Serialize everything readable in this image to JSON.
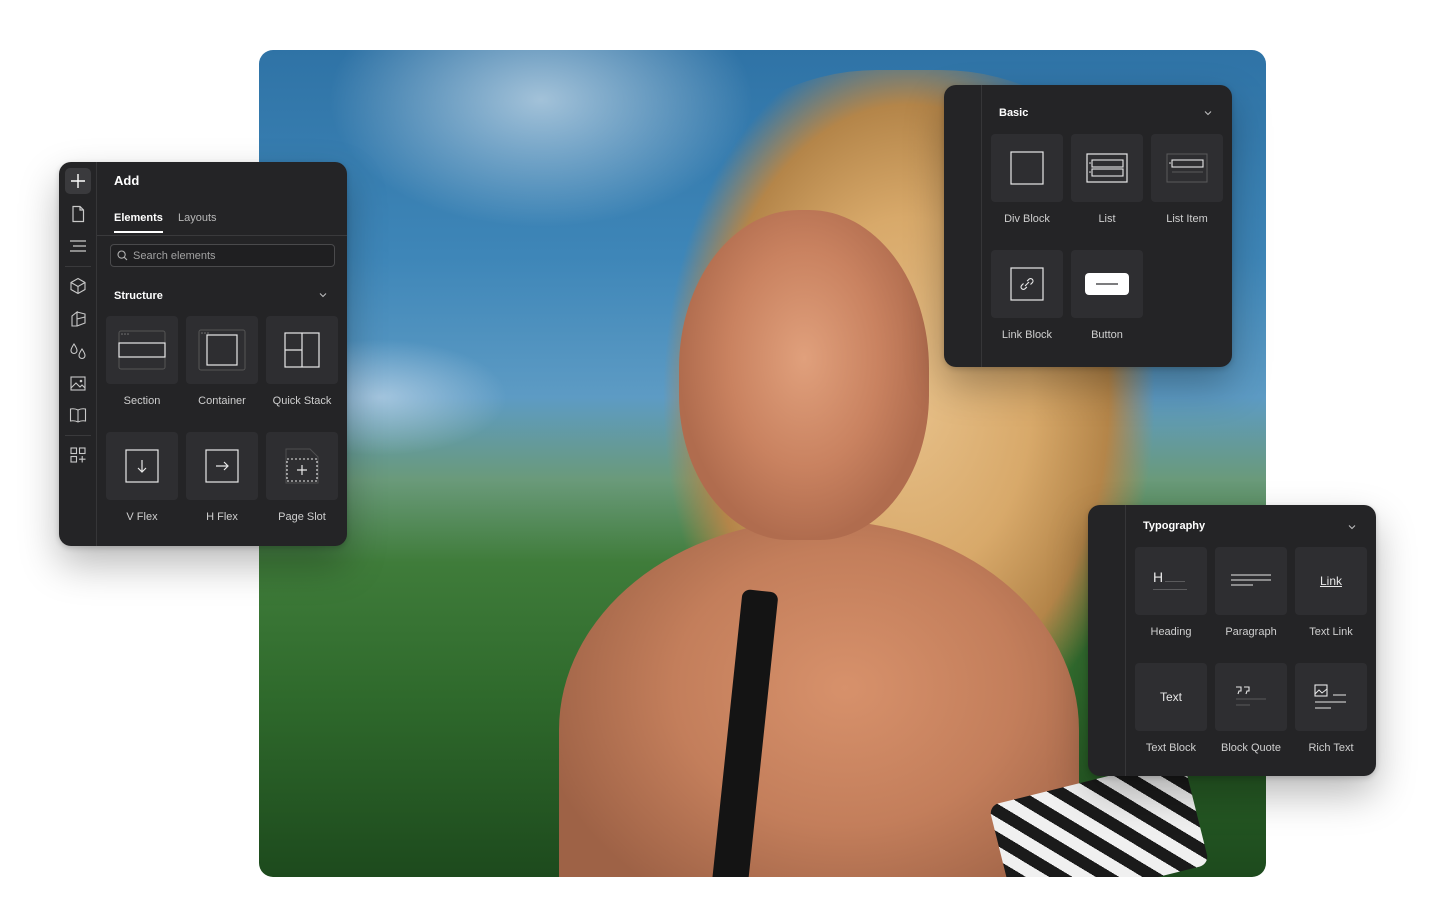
{
  "add_panel": {
    "title": "Add",
    "tabs": [
      {
        "label": "Elements",
        "active": true
      },
      {
        "label": "Layouts",
        "active": false
      }
    ],
    "search_placeholder": "Search elements",
    "section_title": "Structure",
    "items": [
      {
        "label": "Section",
        "icon": "section-icon"
      },
      {
        "label": "Container",
        "icon": "container-icon"
      },
      {
        "label": "Quick Stack",
        "icon": "quick-stack-icon"
      },
      {
        "label": "V Flex",
        "icon": "v-flex-icon"
      },
      {
        "label": "H Flex",
        "icon": "h-flex-icon"
      },
      {
        "label": "Page Slot",
        "icon": "page-slot-icon"
      }
    ],
    "rail_icons": [
      "plus-icon",
      "page-icon",
      "navigator-icon",
      "components-icon",
      "styles-icon",
      "variables-icon",
      "assets-icon",
      "cms-icon",
      "apps-icon"
    ]
  },
  "basic_panel": {
    "section_title": "Basic",
    "items": [
      {
        "label": "Div Block",
        "icon": "div-block-icon"
      },
      {
        "label": "List",
        "icon": "list-icon"
      },
      {
        "label": "List Item",
        "icon": "list-item-icon"
      },
      {
        "label": "Link Block",
        "icon": "link-block-icon"
      },
      {
        "label": "Button",
        "icon": "button-icon"
      }
    ]
  },
  "typography_panel": {
    "section_title": "Typography",
    "items": [
      {
        "label": "Heading",
        "icon": "heading-icon",
        "glyph": "H"
      },
      {
        "label": "Paragraph",
        "icon": "paragraph-icon"
      },
      {
        "label": "Text Link",
        "icon": "text-link-icon",
        "glyph": "Link"
      },
      {
        "label": "Text Block",
        "icon": "text-block-icon",
        "glyph": "Text"
      },
      {
        "label": "Block Quote",
        "icon": "block-quote-icon"
      },
      {
        "label": "Rich Text",
        "icon": "rich-text-icon"
      }
    ]
  },
  "colors": {
    "panel_bg": "#242426",
    "tile_bg": "#2e2e31",
    "text_primary": "#ffffff",
    "text_secondary": "#cfcfcf"
  }
}
